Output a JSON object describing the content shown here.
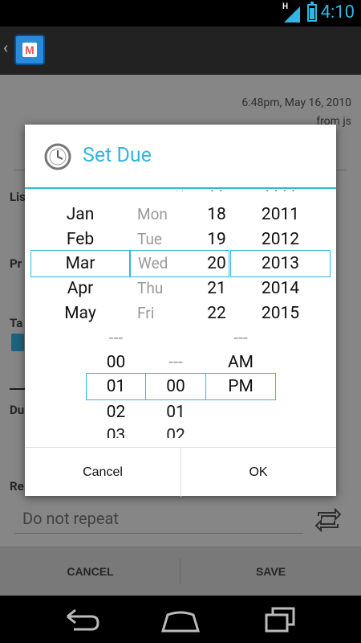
{
  "status": {
    "time": "4:10",
    "network": "H"
  },
  "form": {
    "timestamp": "6:48pm, May 16, 2010",
    "from": "from js",
    "labels": {
      "list": "Lis",
      "priority": "Pr",
      "tags": "Ta",
      "due": "Du",
      "repeat": "Re"
    },
    "repeat_value": "Do not repeat"
  },
  "bottom": {
    "cancel": "CANCEL",
    "save": "SAVE"
  },
  "dialog": {
    "title": "Set Due",
    "months": [
      "Jan",
      "Feb",
      "Mar",
      "Apr",
      "May"
    ],
    "selected_month": "Mar",
    "weekdays": [
      "Mon",
      "Tue",
      "Wed",
      "Thu",
      "Fri"
    ],
    "days": [
      "18",
      "19",
      "20",
      "21",
      "22"
    ],
    "years": [
      "2011",
      "2012",
      "2013",
      "2014",
      "2015"
    ],
    "hours": [
      "---",
      "00",
      "01",
      "02"
    ],
    "minutes": [
      "---",
      "00",
      "01"
    ],
    "ampm": [
      "---",
      "AM",
      "PM"
    ],
    "selected_hour": "01",
    "selected_minute": "00",
    "selected_ampm": "PM",
    "cancel": "Cancel",
    "ok": "OK"
  },
  "colors": {
    "accent": "#33b5e5",
    "dialog_bg": "#ffffff",
    "status_bg": "#000000"
  }
}
